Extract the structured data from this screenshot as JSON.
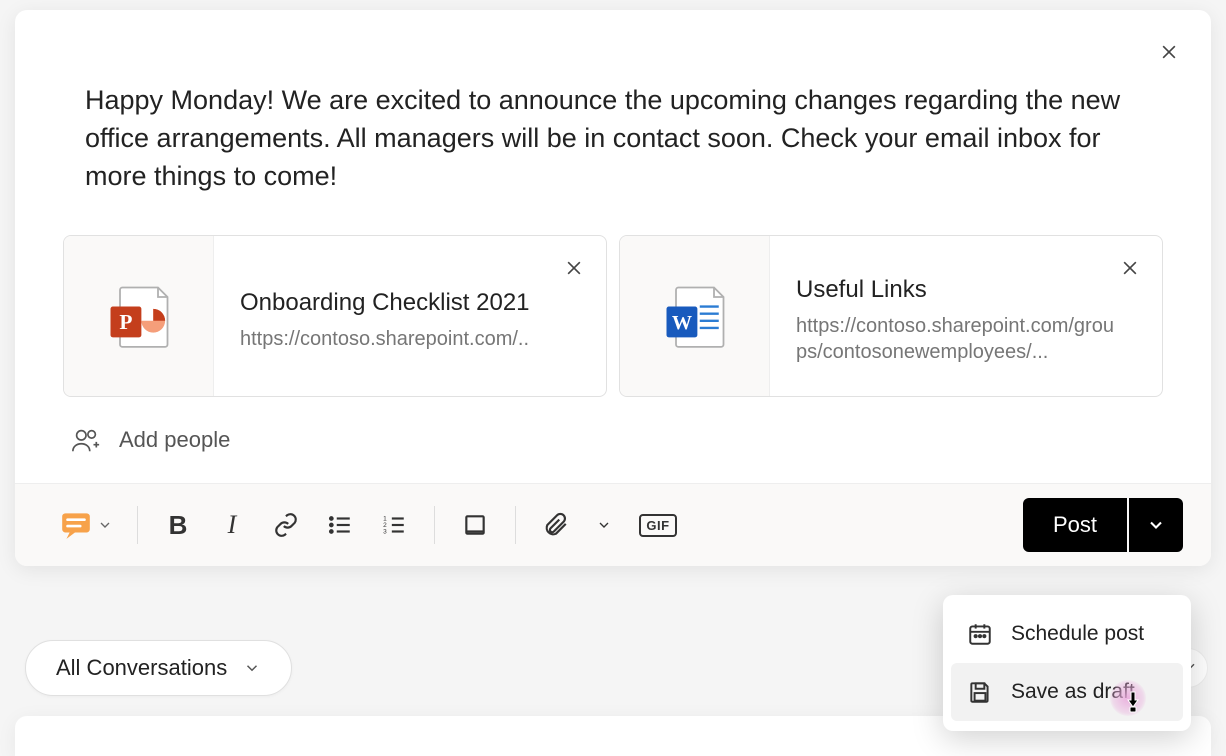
{
  "compose": {
    "message": "Happy Monday! We are excited to announce the upcoming changes regarding the new office arrangements. All managers will be in contact soon. Check your email inbox for more things to come!",
    "attachments": [
      {
        "title": "Onboarding Checklist 2021",
        "url": "https://contoso.sharepoint.com/..",
        "type": "powerpoint"
      },
      {
        "title": "Useful Links",
        "url": "https://contoso.sharepoint.com/groups/contosonewemployees/...",
        "type": "word"
      }
    ],
    "add_people_label": "Add people"
  },
  "toolbar": {
    "post_label": "Post",
    "gif_label": "GIF"
  },
  "post_menu": {
    "items": [
      {
        "label": "Schedule post"
      },
      {
        "label": "Save as draft"
      }
    ]
  },
  "filter": {
    "label": "All Conversations"
  }
}
